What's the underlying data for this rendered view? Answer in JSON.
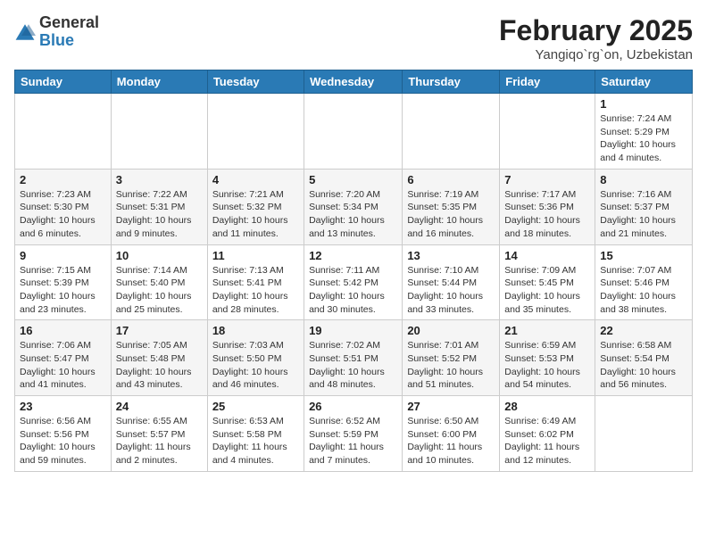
{
  "header": {
    "logo_general": "General",
    "logo_blue": "Blue",
    "month_title": "February 2025",
    "location": "Yangiqo`rg`on, Uzbekistan"
  },
  "weekdays": [
    "Sunday",
    "Monday",
    "Tuesday",
    "Wednesday",
    "Thursday",
    "Friday",
    "Saturday"
  ],
  "weeks": [
    [
      {
        "day": "",
        "info": ""
      },
      {
        "day": "",
        "info": ""
      },
      {
        "day": "",
        "info": ""
      },
      {
        "day": "",
        "info": ""
      },
      {
        "day": "",
        "info": ""
      },
      {
        "day": "",
        "info": ""
      },
      {
        "day": "1",
        "info": "Sunrise: 7:24 AM\nSunset: 5:29 PM\nDaylight: 10 hours and 4 minutes."
      }
    ],
    [
      {
        "day": "2",
        "info": "Sunrise: 7:23 AM\nSunset: 5:30 PM\nDaylight: 10 hours and 6 minutes."
      },
      {
        "day": "3",
        "info": "Sunrise: 7:22 AM\nSunset: 5:31 PM\nDaylight: 10 hours and 9 minutes."
      },
      {
        "day": "4",
        "info": "Sunrise: 7:21 AM\nSunset: 5:32 PM\nDaylight: 10 hours and 11 minutes."
      },
      {
        "day": "5",
        "info": "Sunrise: 7:20 AM\nSunset: 5:34 PM\nDaylight: 10 hours and 13 minutes."
      },
      {
        "day": "6",
        "info": "Sunrise: 7:19 AM\nSunset: 5:35 PM\nDaylight: 10 hours and 16 minutes."
      },
      {
        "day": "7",
        "info": "Sunrise: 7:17 AM\nSunset: 5:36 PM\nDaylight: 10 hours and 18 minutes."
      },
      {
        "day": "8",
        "info": "Sunrise: 7:16 AM\nSunset: 5:37 PM\nDaylight: 10 hours and 21 minutes."
      }
    ],
    [
      {
        "day": "9",
        "info": "Sunrise: 7:15 AM\nSunset: 5:39 PM\nDaylight: 10 hours and 23 minutes."
      },
      {
        "day": "10",
        "info": "Sunrise: 7:14 AM\nSunset: 5:40 PM\nDaylight: 10 hours and 25 minutes."
      },
      {
        "day": "11",
        "info": "Sunrise: 7:13 AM\nSunset: 5:41 PM\nDaylight: 10 hours and 28 minutes."
      },
      {
        "day": "12",
        "info": "Sunrise: 7:11 AM\nSunset: 5:42 PM\nDaylight: 10 hours and 30 minutes."
      },
      {
        "day": "13",
        "info": "Sunrise: 7:10 AM\nSunset: 5:44 PM\nDaylight: 10 hours and 33 minutes."
      },
      {
        "day": "14",
        "info": "Sunrise: 7:09 AM\nSunset: 5:45 PM\nDaylight: 10 hours and 35 minutes."
      },
      {
        "day": "15",
        "info": "Sunrise: 7:07 AM\nSunset: 5:46 PM\nDaylight: 10 hours and 38 minutes."
      }
    ],
    [
      {
        "day": "16",
        "info": "Sunrise: 7:06 AM\nSunset: 5:47 PM\nDaylight: 10 hours and 41 minutes."
      },
      {
        "day": "17",
        "info": "Sunrise: 7:05 AM\nSunset: 5:48 PM\nDaylight: 10 hours and 43 minutes."
      },
      {
        "day": "18",
        "info": "Sunrise: 7:03 AM\nSunset: 5:50 PM\nDaylight: 10 hours and 46 minutes."
      },
      {
        "day": "19",
        "info": "Sunrise: 7:02 AM\nSunset: 5:51 PM\nDaylight: 10 hours and 48 minutes."
      },
      {
        "day": "20",
        "info": "Sunrise: 7:01 AM\nSunset: 5:52 PM\nDaylight: 10 hours and 51 minutes."
      },
      {
        "day": "21",
        "info": "Sunrise: 6:59 AM\nSunset: 5:53 PM\nDaylight: 10 hours and 54 minutes."
      },
      {
        "day": "22",
        "info": "Sunrise: 6:58 AM\nSunset: 5:54 PM\nDaylight: 10 hours and 56 minutes."
      }
    ],
    [
      {
        "day": "23",
        "info": "Sunrise: 6:56 AM\nSunset: 5:56 PM\nDaylight: 10 hours and 59 minutes."
      },
      {
        "day": "24",
        "info": "Sunrise: 6:55 AM\nSunset: 5:57 PM\nDaylight: 11 hours and 2 minutes."
      },
      {
        "day": "25",
        "info": "Sunrise: 6:53 AM\nSunset: 5:58 PM\nDaylight: 11 hours and 4 minutes."
      },
      {
        "day": "26",
        "info": "Sunrise: 6:52 AM\nSunset: 5:59 PM\nDaylight: 11 hours and 7 minutes."
      },
      {
        "day": "27",
        "info": "Sunrise: 6:50 AM\nSunset: 6:00 PM\nDaylight: 11 hours and 10 minutes."
      },
      {
        "day": "28",
        "info": "Sunrise: 6:49 AM\nSunset: 6:02 PM\nDaylight: 11 hours and 12 minutes."
      },
      {
        "day": "",
        "info": ""
      }
    ]
  ]
}
